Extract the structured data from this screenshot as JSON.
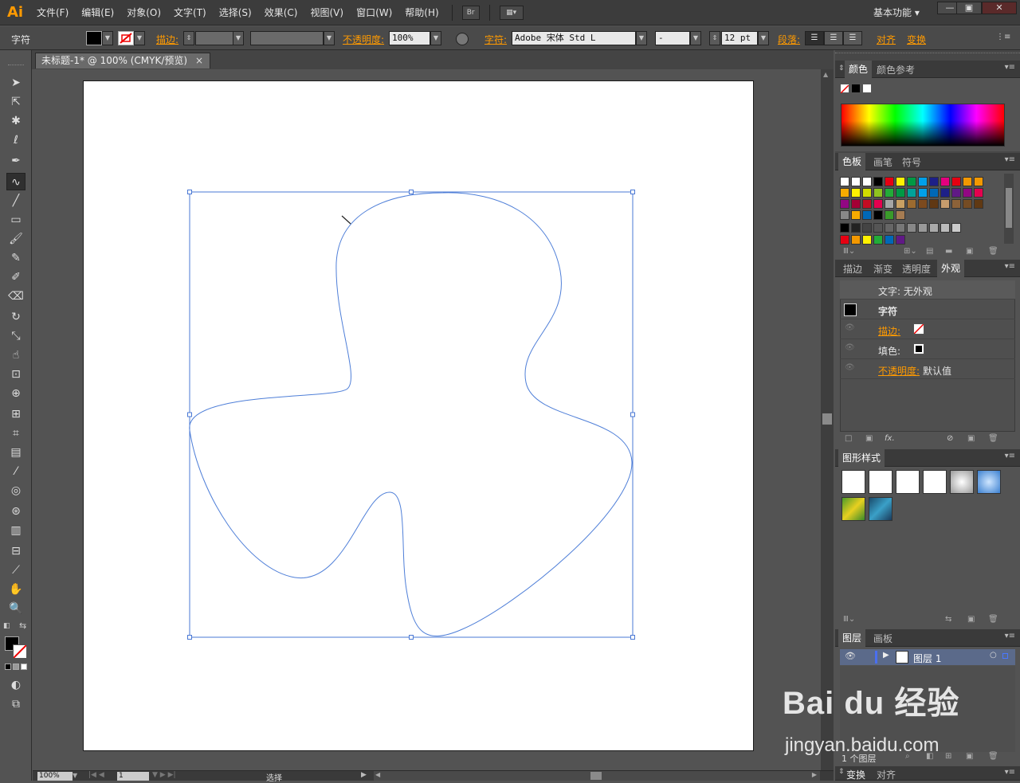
{
  "app": {
    "logo": "Ai",
    "bridge_label": "Br",
    "workspace": "基本功能"
  },
  "menu": [
    "文件(F)",
    "编辑(E)",
    "对象(O)",
    "文字(T)",
    "选择(S)",
    "效果(C)",
    "视图(V)",
    "窗口(W)",
    "帮助(H)"
  ],
  "window_buttons": {
    "minimize": "—",
    "restore": "▣",
    "close": "✕"
  },
  "controlbar": {
    "mode": "字符",
    "stroke_label": "描边:",
    "opacity_label": "不透明度:",
    "opacity_value": "100%",
    "char_label": "字符:",
    "font_value": "Adobe 宋体 Std L",
    "style_value": "-",
    "size_value": "12 pt",
    "para_label": "段落:",
    "align_label": "对齐",
    "transform_label": "变换"
  },
  "document": {
    "tab_title": "未标题-1* @ 100% (CMYK/预览)",
    "close": "×"
  },
  "status": {
    "zoom": "100%",
    "page": "1",
    "tool": "选择"
  },
  "tools": [
    "selection-tool",
    "direct-selection-tool",
    "magic-wand-tool",
    "lasso-tool",
    "pen-tool",
    "curvature-type-tool",
    "line-tool",
    "rectangle-tool",
    "paintbrush-tool",
    "pencil-tool",
    "blob-brush-tool",
    "eraser-tool",
    "rotate-tool",
    "scale-tool",
    "warp-tool",
    "free-transform-tool",
    "shape-builder-tool",
    "perspective-grid-tool",
    "mesh-tool",
    "gradient-tool",
    "eyedropper-tool",
    "blend-tool",
    "symbol-sprayer-tool",
    "column-graph-tool",
    "artboard-tool",
    "slice-tool",
    "hand-tool",
    "zoom-tool"
  ],
  "panels": {
    "color": {
      "tabs": [
        "颜色",
        "颜色参考"
      ]
    },
    "swatches": {
      "tabs": [
        "色板",
        "画笔",
        "符号"
      ]
    },
    "appearance": {
      "tabs": [
        "描边",
        "渐变",
        "透明度",
        "外观"
      ],
      "header": "文字: 无外观",
      "char_row": "字符",
      "stroke_row": "描边:",
      "fill_row": "填色:",
      "opacity_row": "不透明度:",
      "opacity_value": "默认值",
      "fx": "fx."
    },
    "graphic_styles": {
      "title": "图形样式"
    },
    "layers": {
      "tabs": [
        "图层",
        "画板"
      ],
      "layer_name": "图层 1",
      "count": "1 个图层"
    },
    "bottom_tabs": [
      "变换",
      "对齐"
    ]
  },
  "watermark": {
    "brand": "Bai du 经验",
    "url": "jingyan.baidu.com"
  },
  "colors": {
    "accent_orange": "#ff9a00",
    "selection_blue": "#4a78d4",
    "path_blue": "#4f7fd8",
    "panel_bg": "#535353",
    "menu_bg": "#3c3c3c"
  }
}
